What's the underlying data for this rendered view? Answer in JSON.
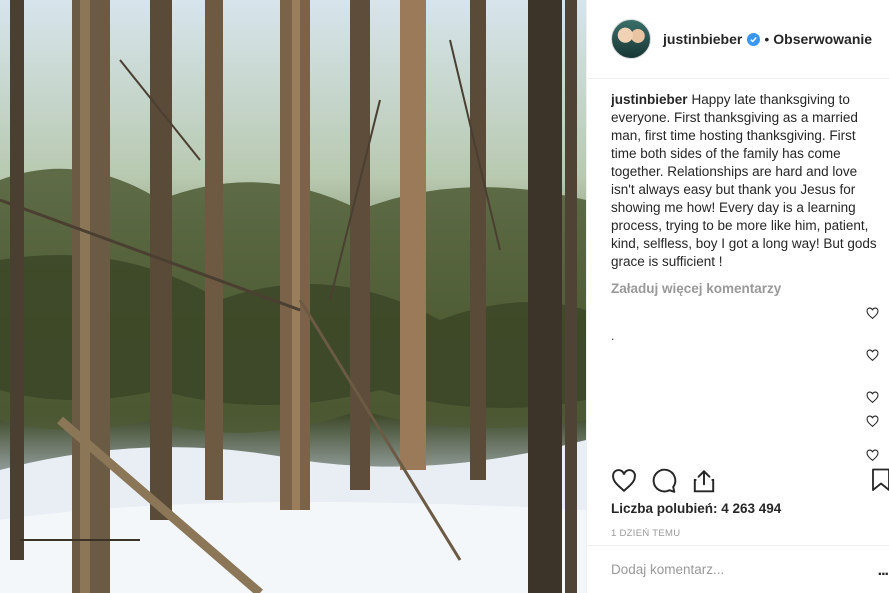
{
  "post": {
    "username": "justinbieber",
    "follow_status": "Obserwowanie",
    "separator": "•",
    "caption": "Happy late thanksgiving to everyone. First thanksgiving as a married man, first time hosting thanksgiving. First time both sides of the family has come together. Relationships are hard and love isn't always easy but thank you Jesus for showing me how! Every day is a learning process, trying to be more like him, patient, kind, selfless, boy I got a long way! But gods grace is sufficient !",
    "load_more_label": "Załaduj więcej komentarzy",
    "comment_fragment": ".",
    "likes_text": "Liczba polubień: 4 263 494",
    "timestamp": "1 DZIEŃ TEMU",
    "comment_placeholder": "Dodaj komentarz...",
    "more_options": "..."
  },
  "colors": {
    "text": "#262626",
    "muted": "#999999",
    "verified": "#3897f0",
    "border": "#efefef"
  },
  "icons": {
    "verified": "verified-badge-icon",
    "like": "heart-icon",
    "comment": "speech-bubble-icon",
    "share": "share-icon",
    "save": "bookmark-icon"
  }
}
